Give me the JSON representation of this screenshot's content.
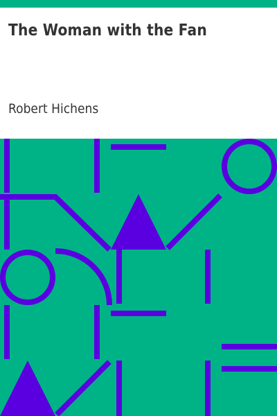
{
  "book": {
    "title": "The Woman with the Fan",
    "author": "Robert Hichens"
  },
  "colors": {
    "accent_band": "#00b386",
    "pattern_background": "#00b386",
    "pattern_shapes": "#5a00e0",
    "text": "#333333",
    "page": "#ffffff"
  }
}
